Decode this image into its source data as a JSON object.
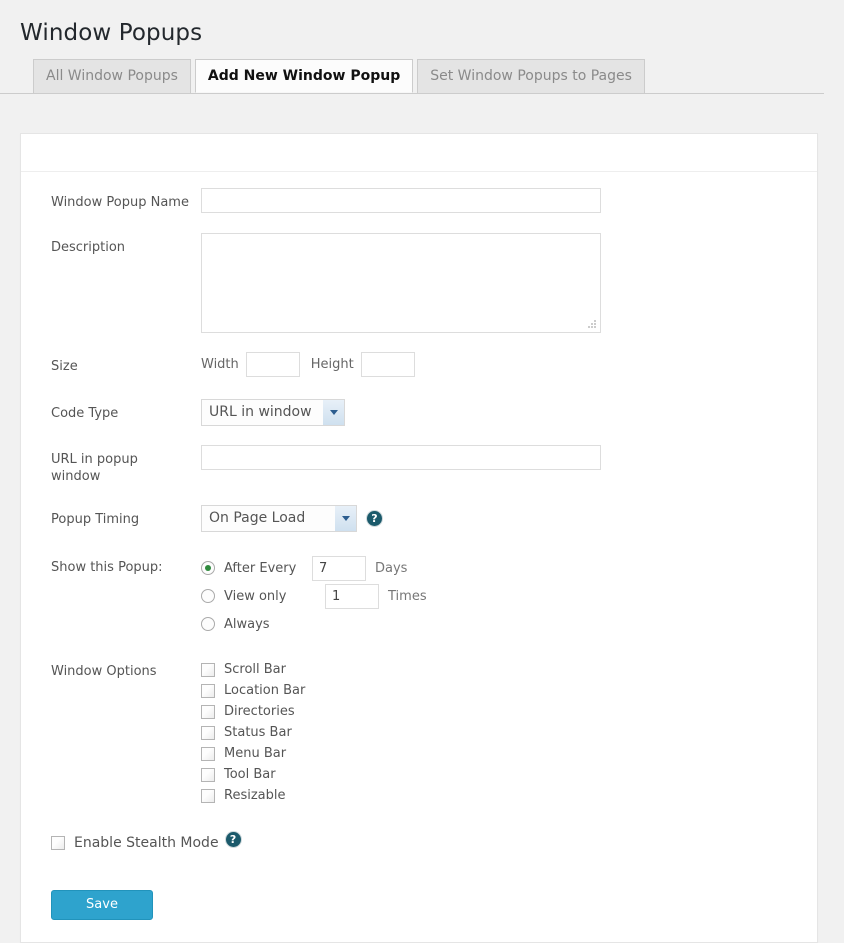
{
  "page": {
    "title": "Window Popups"
  },
  "tabs": [
    {
      "label": "All Window Popups",
      "active": false
    },
    {
      "label": "Add New Window Popup",
      "active": true
    },
    {
      "label": "Set Window Popups to Pages",
      "active": false
    }
  ],
  "form": {
    "name": {
      "label": "Window Popup Name",
      "value": "",
      "placeholder": ""
    },
    "description": {
      "label": "Description",
      "value": "",
      "placeholder": ""
    },
    "size": {
      "label": "Size",
      "width_label": "Width",
      "width_value": "",
      "height_label": "Height",
      "height_value": ""
    },
    "code_type": {
      "label": "Code Type",
      "selected": "URL in window"
    },
    "url": {
      "label": "URL in popup window",
      "value": "",
      "placeholder": ""
    },
    "popup_timing": {
      "label": "Popup Timing",
      "selected": "On Page Load",
      "help_icon": "help-question-icon",
      "help_glyph": "?"
    },
    "show_popup": {
      "label": "Show this Popup:",
      "options": [
        {
          "label": "After Every",
          "selected": true,
          "value": "7",
          "suffix": "Days"
        },
        {
          "label": "View only",
          "selected": false,
          "value": "1",
          "suffix": "Times"
        },
        {
          "label": "Always",
          "selected": false,
          "value": null,
          "suffix": ""
        }
      ]
    },
    "window_options": {
      "label": "Window Options",
      "items": [
        {
          "label": "Scroll Bar",
          "checked": false
        },
        {
          "label": "Location Bar",
          "checked": false
        },
        {
          "label": "Directories",
          "checked": false
        },
        {
          "label": "Status Bar",
          "checked": false
        },
        {
          "label": "Menu Bar",
          "checked": false
        },
        {
          "label": "Tool Bar",
          "checked": false
        },
        {
          "label": "Resizable",
          "checked": false
        }
      ]
    },
    "stealth": {
      "label": "Enable Stealth Mode",
      "checked": false,
      "help_icon": "help-question-icon",
      "help_glyph": "?"
    },
    "save": {
      "label": "Save"
    }
  },
  "colors": {
    "accent": "#2ea3cd",
    "help_icon": "#1b5a6b",
    "radio_dot": "#2f8a3d",
    "page_bg": "#f1f1f1",
    "panel_bg": "#ffffff"
  }
}
